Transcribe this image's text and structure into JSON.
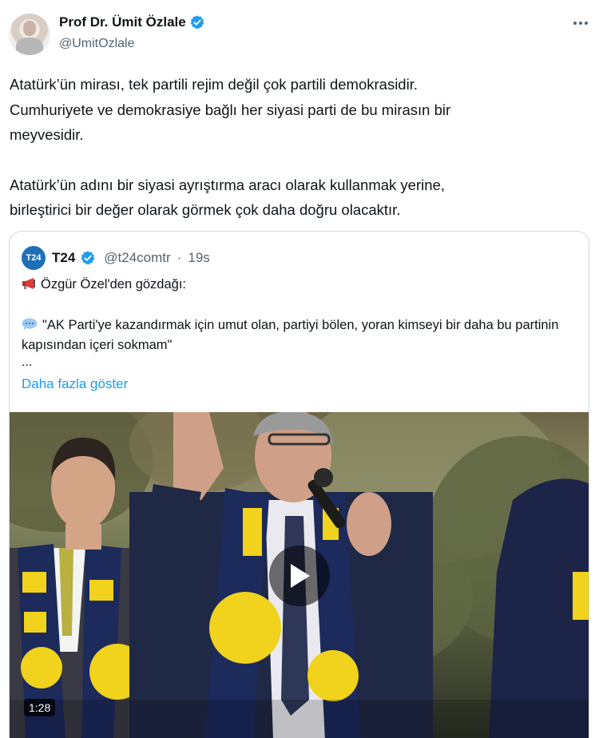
{
  "author": {
    "display_name": "Prof Dr. Ümit Özlale",
    "handle": "@UmitOzlale",
    "verified": true
  },
  "more_icon": "more-horizontal-icon",
  "tweet": {
    "paragraph1": "Atatürk’ün mirası, tek partili rejim değil çok partili demokrasidir.\nCumhuriyete ve demokrasiye bağlı her siyasi parti de bu mirasın bir\nmeyvesidir.",
    "paragraph2": "Atatürk’ün adını bir siyasi ayrıştırma aracı olarak kullanmak yerine,\nbirleştirici bir değer olarak görmek çok daha doğru olacaktır."
  },
  "quote": {
    "logo_text": "T24",
    "name": "T24",
    "handle": "@t24comtr",
    "separator": "·",
    "time": "19s",
    "line1": "Özgür Özel'den gözdağı:",
    "line2": "\"AK Parti'ye kazandırmak için umut olan, partiyi bölen, yoran kimseyi bir daha bu partinin kapısından içeri sokmam\"",
    "ellipsis": "...",
    "show_more": "Daha fazla göster",
    "video": {
      "duration": "1:28",
      "play_icon": "play-icon"
    }
  },
  "colors": {
    "link": "#1d9bf0",
    "verified": "#1d9bf0",
    "secondary_text": "#536471",
    "border": "#cfd9de",
    "t24_logo": "#1d6fb8",
    "scarf_yellow": "#f1d21c",
    "scarf_navy": "#1c2a5c"
  }
}
